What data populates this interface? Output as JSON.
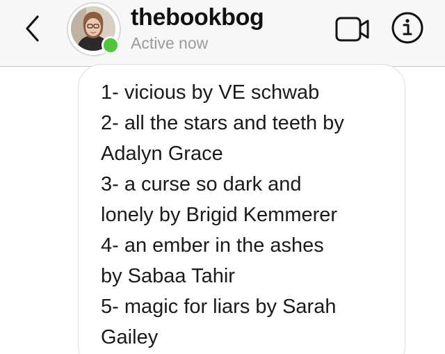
{
  "header": {
    "username": "thebookbog",
    "status": "Active now",
    "icons": {
      "back": "chevron-left-icon",
      "video": "video-camera-icon",
      "info": "info-icon"
    },
    "online_color": "#4ec83a"
  },
  "message": {
    "lines": [
      "1- vicious by VE schwab",
      "2- all the stars and teeth by",
      "Adalyn Grace",
      "3- a curse so dark and",
      "lonely by Brigid Kemmerer",
      "4- an ember in the ashes",
      "by Sabaa Tahir",
      "5- magic for liars by Sarah",
      "Gailey"
    ]
  }
}
